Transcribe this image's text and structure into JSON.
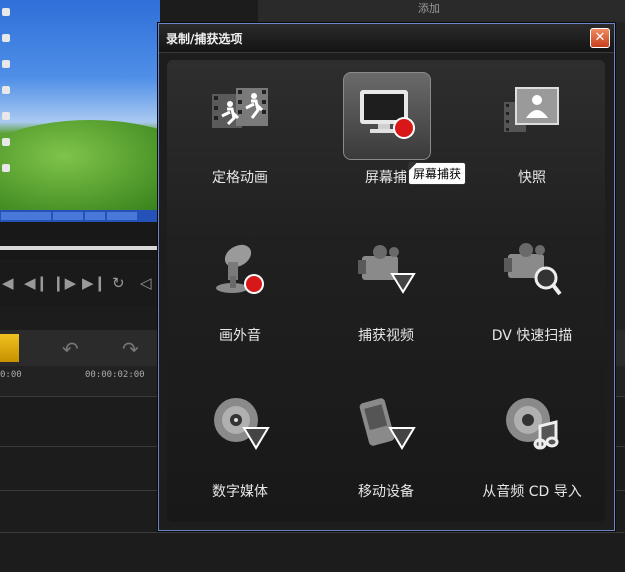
{
  "dialog": {
    "title": "录制/捕获选项",
    "close_label": "✕",
    "items": [
      {
        "label": "定格动画",
        "icon": "stop-motion-icon"
      },
      {
        "label": "屏幕捕获",
        "icon": "screen-capture-icon"
      },
      {
        "label": "快照",
        "icon": "snapshot-icon"
      },
      {
        "label": "画外音",
        "icon": "voiceover-icon"
      },
      {
        "label": "捕获视频",
        "icon": "capture-video-icon"
      },
      {
        "label": "DV 快速扫描",
        "icon": "dv-quick-scan-icon"
      },
      {
        "label": "数字媒体",
        "icon": "digital-media-icon"
      },
      {
        "label": "移动设备",
        "icon": "mobile-device-icon"
      },
      {
        "label": "从音频 CD 导入",
        "icon": "audio-cd-import-icon"
      }
    ],
    "tooltip": "屏幕捕获",
    "selected_index": 1,
    "selected_visible_label": "屏幕捕"
  },
  "background": {
    "timeline_ticks": [
      "0:00",
      "00:00:02:00"
    ],
    "top_tab_label": "添加"
  },
  "colors": {
    "dialog_border": "#6a86c8",
    "close_button": "#d8532c",
    "record_dot": "#d81818"
  }
}
